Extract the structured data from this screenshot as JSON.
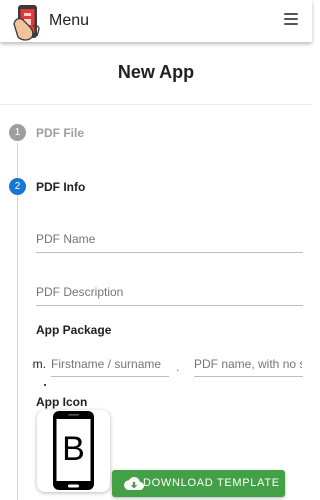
{
  "header": {
    "menu_label": "Menu",
    "logo_icon": "phone-in-hand-icon",
    "menu_icon": "hamburger-icon"
  },
  "page": {
    "title": "New App"
  },
  "stepper": {
    "steps": [
      {
        "number": "1",
        "label": "PDF File",
        "state": "completed",
        "color": "#9e9e9e"
      },
      {
        "number": "2",
        "label": "PDF Info",
        "state": "active",
        "color": "#1976d2"
      }
    ]
  },
  "form": {
    "pdf_name": {
      "placeholder": "PDF Name",
      "value": ""
    },
    "pdf_description": {
      "placeholder": "PDF Description",
      "value": ""
    },
    "app_package": {
      "label": "App Package",
      "prefix": "com.",
      "separator": ".",
      "part1_placeholder": "Firstname / surname",
      "part2_placeholder": "PDF name, with no spaces"
    },
    "app_icon": {
      "label": "App Icon",
      "letter": "B",
      "icon": "smartphone-icon"
    }
  },
  "actions": {
    "download_label": "DOWNLOAD TEMPLATE",
    "download_icon": "cloud-download-icon",
    "download_color": "#43a047"
  }
}
